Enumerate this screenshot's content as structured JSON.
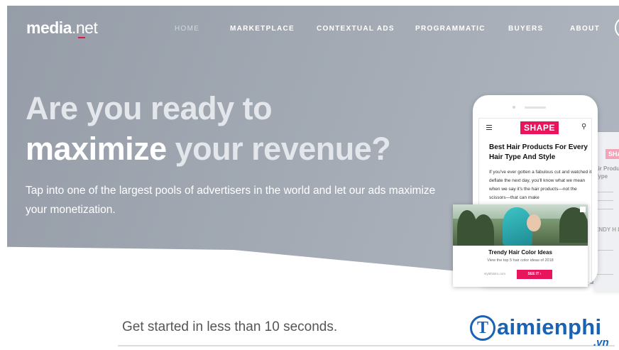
{
  "brand": {
    "logo_bold": "media",
    "logo_rest": ".net"
  },
  "nav": {
    "items": [
      {
        "label": "HOME"
      },
      {
        "label": "MARKETPLACE"
      },
      {
        "label": "CONTEXTUAL ADS"
      },
      {
        "label": "PROGRAMMATIC"
      },
      {
        "label": "BUYERS"
      },
      {
        "label": "ABOUT"
      }
    ]
  },
  "hero": {
    "headline_part1": "Are you ready to",
    "headline_strong": "maximize",
    "headline_part2": "your revenue?",
    "subtext": "Tap into one of the largest pools of advertisers in the world and let our ads maximize your monetization."
  },
  "phone": {
    "logo": "SHAPE",
    "article_title": "Best Hair Products For Every Hair Type And Style",
    "article_body": "If you've ever gotten a fabulous cut and watched it deflate the next day, you'll know what we mean when we say it's the hair products—not the scissors—that can make"
  },
  "second_card": {
    "logo": "SHA",
    "text_a": "air Produ Hair Type",
    "text_b": "ENDY H LOR ID"
  },
  "ad": {
    "title": "Trendy Hair Color Ideas",
    "subtitle": "View the top 5 hair color ideas of 2018",
    "source": "stylebistro.com",
    "button": "SEE IT ›"
  },
  "get_started": "Get started in less than 10 seconds.",
  "watermark": {
    "letter": "T",
    "text": "aimienphi",
    "suffix": ".vn"
  },
  "colors": {
    "accent": "#e8145c",
    "hero_bg": "#a2a9b3",
    "watermark": "#1a62b4"
  }
}
